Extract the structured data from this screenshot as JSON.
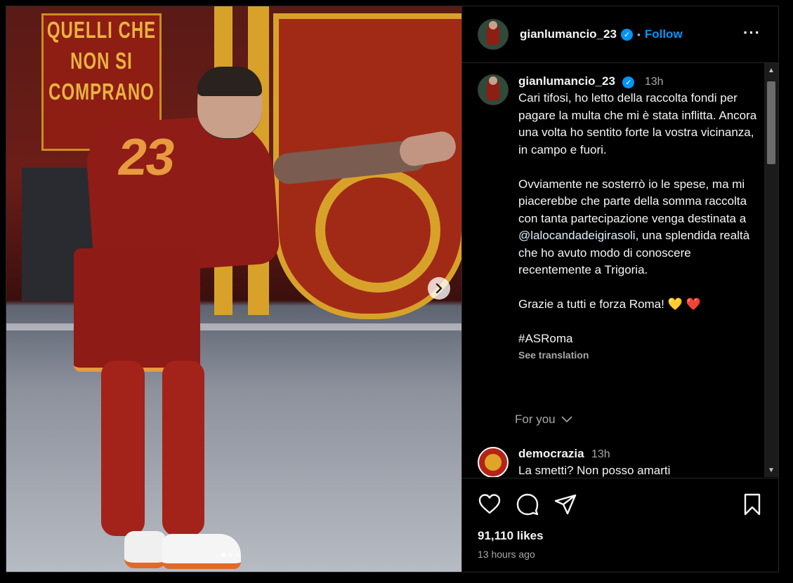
{
  "post": {
    "username": "gianlumancio_23",
    "follow_label": "Follow",
    "separator": "•",
    "more_label": "···"
  },
  "caption": {
    "username": "gianlumancio_23",
    "time": "13h",
    "text_part1": "Cari tifosi, ho letto della raccolta fondi per pagare la multa che mi è stata inflitta. Ancora una volta ho sentito forte la vostra vicinanza, in campo e fuori.\n\nOvviamente ne sosterrò io le spese, ma mi piacerebbe che parte della somma raccolta con tanta partecipazione venga destinata a ",
    "mention": "@lalocandadeigirasoli",
    "text_part2": ", una splendida realtà che ho avuto modo di conoscere recentemente a Trigoria.\n\nGrazie a tutti e forza Roma! 💛 ❤️\n\n#ASRoma",
    "see_translation": "See translation"
  },
  "for_you_label": "For you",
  "comments": [
    {
      "username": "democrazia",
      "time": "13h",
      "text": "La smetti? Non posso amarti"
    }
  ],
  "likes_text": "91,110 likes",
  "posted_ago": "13 hours ago",
  "media": {
    "banner_text": [
      "QUELLI CHE",
      "NON SI",
      "COMPRANO"
    ],
    "jersey_number": "23",
    "carousel_dots": 3,
    "active_dot": 0,
    "next_icon": "chevron-right-icon"
  },
  "colors": {
    "accent": "#0095f6",
    "secondary_text": "#a8a8a8",
    "background": "#000000"
  }
}
